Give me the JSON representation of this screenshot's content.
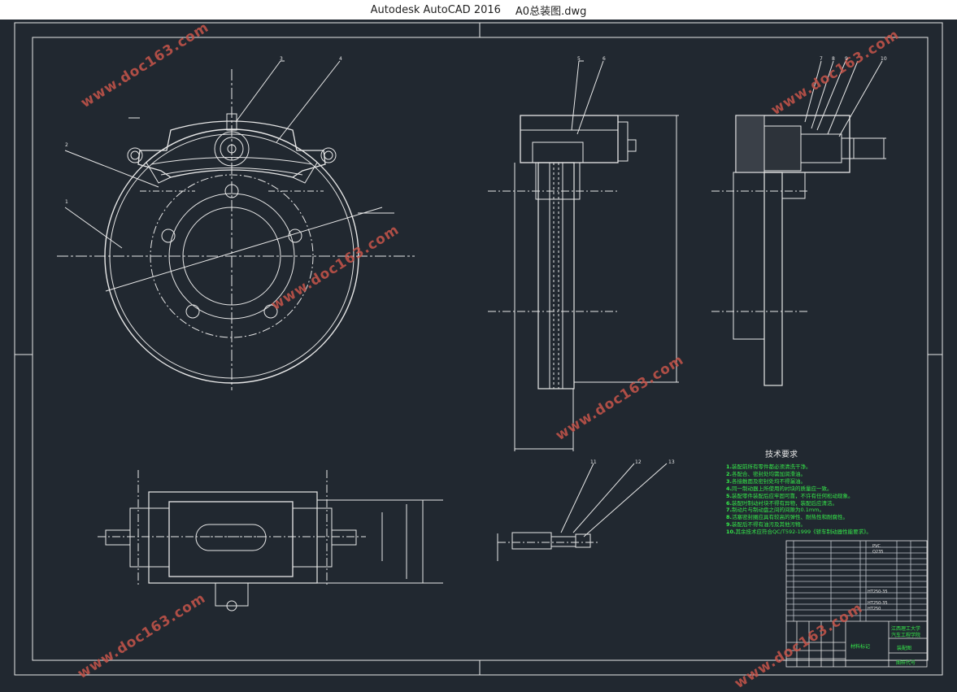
{
  "window": {
    "app_name": "Autodesk AutoCAD 2016",
    "file_name": "A0总装图.dwg"
  },
  "colors": {
    "background": "#212830",
    "line": "#e8e8e8",
    "green_text": "#35e84a",
    "watermark": "#c8554a",
    "titlebar": "#ffffff"
  },
  "watermark_text": "www.doc163.com",
  "tech_requirements": {
    "title": "技术要求",
    "items": [
      {
        "num": "1.",
        "text": "装配前所有零件都必须清洗干净。"
      },
      {
        "num": "2.",
        "text": "各配合、密封处均需加润滑油。"
      },
      {
        "num": "3.",
        "text": "各接触面及密封处均不得漏油。"
      },
      {
        "num": "4.",
        "text": "同一制动器上所使用的衬块的质量应一致。"
      },
      {
        "num": "5.",
        "text": "装配零件装配后应牢固可靠，不许有任何松动现象。"
      },
      {
        "num": "6.",
        "text": "装配时制动衬块不得有异物，装配后应清洁。"
      },
      {
        "num": "7.",
        "text": "制动片与制动盘之间的间隙为0.1mm。"
      },
      {
        "num": "8.",
        "text": "活塞密封圈应具有较高的弹性、耐热性和耐腐性。"
      },
      {
        "num": "9.",
        "text": "装配后不得有油污及其他污物。"
      },
      {
        "num": "10.",
        "text": "其余技术应符合QC/T592-1999《轿车制动器性能要求》。"
      }
    ]
  },
  "part_numbers": [
    "3",
    "4",
    "5",
    "6",
    "7",
    "8",
    "9",
    "10",
    "11",
    "12",
    "13",
    "2",
    "1"
  ],
  "title_block": {
    "rows": [
      "13",
      "12",
      "11",
      "10",
      "9",
      "8",
      "7",
      "6",
      "5",
      "4",
      "3",
      "2",
      "1"
    ],
    "materials": [
      "PVC",
      "Q235",
      "HT250-35",
      "HT250-35",
      "HT250"
    ],
    "school": "江西理工大学",
    "college": "汽车工程学院",
    "fields": [
      "材料标记",
      "装配图",
      "图样代号"
    ]
  }
}
